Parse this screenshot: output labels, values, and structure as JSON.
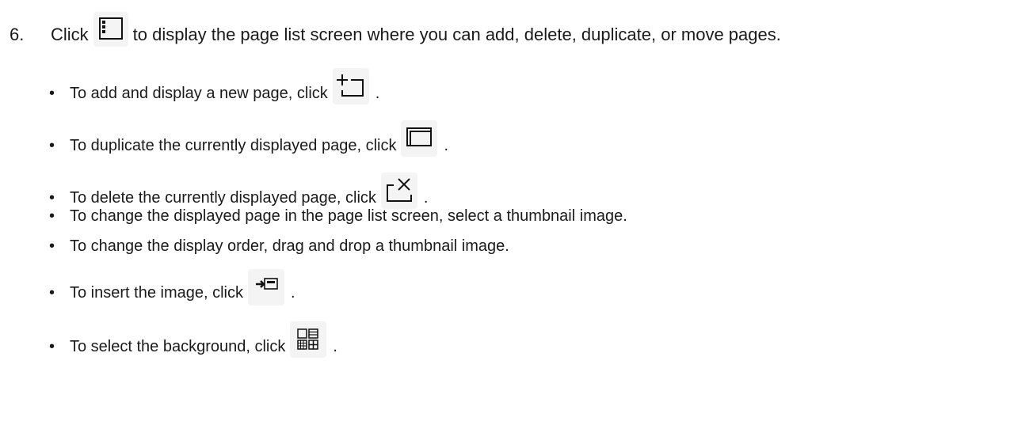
{
  "step": {
    "number": "6.",
    "text_before": "Click",
    "icon": "page-list-icon",
    "text_after": "to display the page list screen where you can add, delete, duplicate, or move pages."
  },
  "bullets": [
    {
      "text": "To add and display a new page, click",
      "icon": "add-page-icon",
      "end": "."
    },
    {
      "text": "To duplicate the currently displayed page, click",
      "icon": "duplicate-page-icon",
      "end": "."
    },
    {
      "text": "To delete the currently displayed page, click",
      "icon": "delete-page-icon",
      "end": "."
    },
    {
      "text": "To change the displayed page in the page list screen, select a thumbnail image.",
      "icon": null,
      "end": ""
    },
    {
      "text": "To change the display order, drag and drop a thumbnail image.",
      "icon": null,
      "end": ""
    },
    {
      "text": "To insert the image, click",
      "icon": "insert-image-icon",
      "end": "."
    },
    {
      "text": "To select the background, click",
      "icon": "background-select-icon",
      "end": "."
    }
  ],
  "bullet_glyph": "•"
}
